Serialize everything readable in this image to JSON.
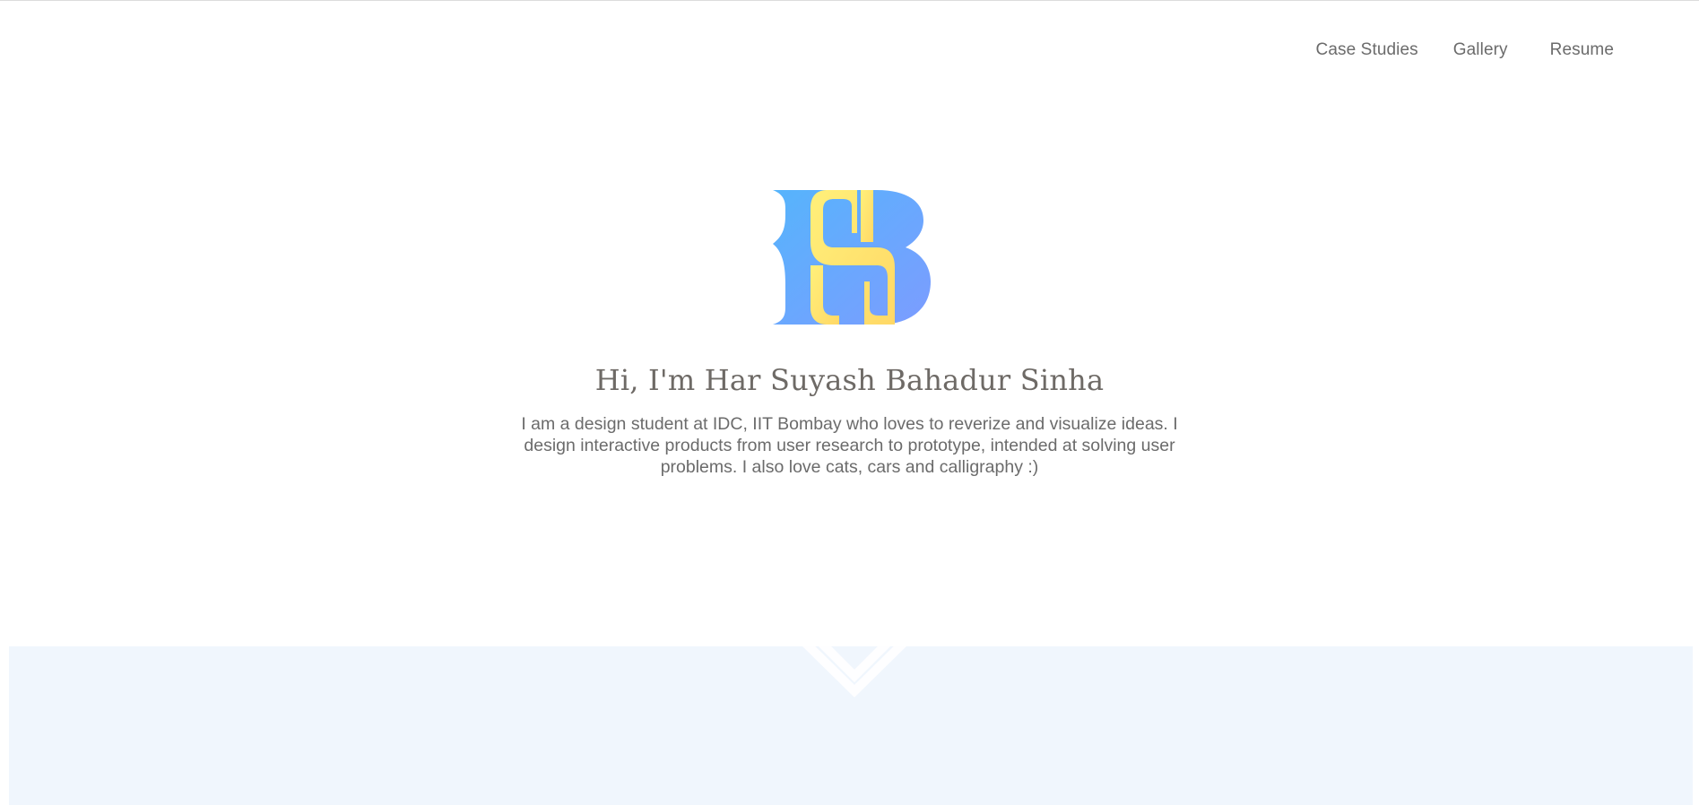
{
  "nav": {
    "items": [
      {
        "label": "Case Studies"
      },
      {
        "label": "Gallery"
      },
      {
        "label": "Resume"
      }
    ]
  },
  "hero": {
    "title": "Hi, I'm Har Suyash Bahadur Sinha",
    "description": "I am a design student at IDC, IIT Bombay who loves to reverize and visualize ideas. I design interactive products from user research to prototype, intended at solving user problems. I also love cats, cars and calligraphy :)"
  },
  "logo": {
    "icon": "hsb-monogram-logo",
    "colors": {
      "blue_start": "#56b4fc",
      "blue_end": "#7c9cff",
      "yellow_start": "#fff07a",
      "yellow_end": "#ffd866"
    }
  },
  "band": {
    "background": "#f0f6fd",
    "icon": "scroll-down-chevron-icon"
  }
}
